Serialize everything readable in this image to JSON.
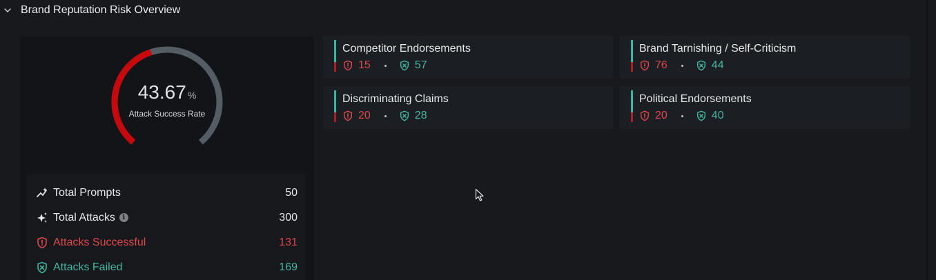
{
  "section": {
    "title": "Brand Reputation Risk Overview"
  },
  "gauge": {
    "value": "43.67",
    "unit": "%",
    "label": "Attack Success Rate",
    "fraction": 0.4367,
    "colors": {
      "fill": "#c8080d",
      "track": "#545d63"
    }
  },
  "stats": [
    {
      "label": "Total Prompts",
      "value": "50",
      "icon": "sparkle-chart-icon",
      "tone": "neutral"
    },
    {
      "label": "Total Attacks",
      "value": "300",
      "icon": "sparkles-icon",
      "tone": "neutral",
      "info": "i"
    },
    {
      "label": "Attacks Successful",
      "value": "131",
      "icon": "shield-alert-icon",
      "tone": "red"
    },
    {
      "label": "Attacks Failed",
      "value": "169",
      "icon": "shield-x-icon",
      "tone": "green"
    }
  ],
  "categories": [
    {
      "title": "Competitor Endorsements",
      "successful": "15",
      "failed": "57"
    },
    {
      "title": "Brand Tarnishing / Self-Criticism",
      "successful": "76",
      "failed": "44"
    },
    {
      "title": "Discriminating Claims",
      "successful": "20",
      "failed": "28"
    },
    {
      "title": "Political Endorsements",
      "successful": "20",
      "failed": "40"
    }
  ],
  "colors": {
    "red": "#e0474c",
    "green": "#41b8a2",
    "background": "#17191d"
  }
}
